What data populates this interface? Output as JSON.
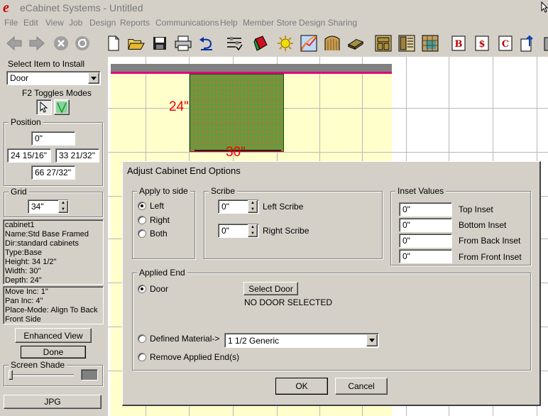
{
  "app": {
    "title": "eCabinet Systems - Untitled",
    "logo_letter": "e"
  },
  "menu": [
    "File",
    "Edit",
    "View",
    "Job",
    "Design",
    "Reports",
    "Communications",
    "Help",
    "Member Store",
    "Design Sharing"
  ],
  "toolbar_icons": [
    "back-icon",
    "forward-icon",
    "stop-icon",
    "refresh-icon",
    "new-file-icon",
    "open-folder-icon",
    "save-icon",
    "print-icon",
    "undo-icon",
    "settings-icon",
    "paint-icon",
    "light-icon",
    "chart-icon",
    "door-icon",
    "board-icon",
    "cabinet-icon",
    "cabinet-list-icon",
    "grid-icon",
    "bill-icon",
    "cost-icon",
    "cutlist-icon",
    "export-icon",
    "trash-icon"
  ],
  "left": {
    "select_item_label": "Select Item to Install",
    "select_item_value": "Door",
    "f2_label": "F2 Toggles Modes",
    "position_label": "Position",
    "position_values": [
      "0\"",
      "24 15/16\"",
      "33 21/32\"",
      "66 27/32\""
    ],
    "grid_label": "Grid",
    "grid_value": "34\"",
    "info_lines": [
      "cabinet1",
      "Name:Std Base Framed",
      "Dir:standard cabinets",
      "Type:Base",
      "Height: 34 1/2\"",
      "Width: 30\"",
      "Depth: 24\""
    ],
    "move_lines": [
      "Move Inc: 1\"",
      "Pan Inc: 4\"",
      "Place-Mode: Align To Back",
      "Front Side"
    ],
    "enhanced_view": "Enhanced View",
    "done": "Done",
    "screen_shade": "Screen Shade",
    "jpg": "JPG"
  },
  "canvas": {
    "depth_label": "24\"",
    "width_label": "30\""
  },
  "dialog": {
    "title": "Adjust Cabinet End Options",
    "apply_to_side": {
      "label": "Apply to side",
      "options": [
        "Left",
        "Right",
        "Both"
      ],
      "selected": "Left"
    },
    "scribe": {
      "label": "Scribe",
      "left_value": "0\"",
      "left_label": "Left Scribe",
      "right_value": "0\"",
      "right_label": "Right Scribe"
    },
    "inset": {
      "label": "Inset Values",
      "rows": [
        {
          "value": "0\"",
          "label": "Top Inset"
        },
        {
          "value": "0\"",
          "label": "Bottom Inset"
        },
        {
          "value": "0\"",
          "label": "From Back Inset"
        },
        {
          "value": "0\"",
          "label": "From Front Inset"
        }
      ]
    },
    "applied_end": {
      "label": "Applied End",
      "door_option": "Door",
      "select_door_button": "Select Door",
      "no_door_text": "NO DOOR SELECTED",
      "defined_material_option": "Defined Material->",
      "material_value": "1 1/2 Generic",
      "remove_option": "Remove Applied End(s)",
      "selected": "Door"
    },
    "ok": "OK",
    "cancel": "Cancel"
  },
  "colors": {
    "cabinet_fill": "#8a8a3a",
    "cabinet_grid": "#3fa83f",
    "room_fill": "#ffffcc",
    "wall_bar": "#808080",
    "wall_line": "#e0007a",
    "dimension_text": "#ee0000"
  }
}
